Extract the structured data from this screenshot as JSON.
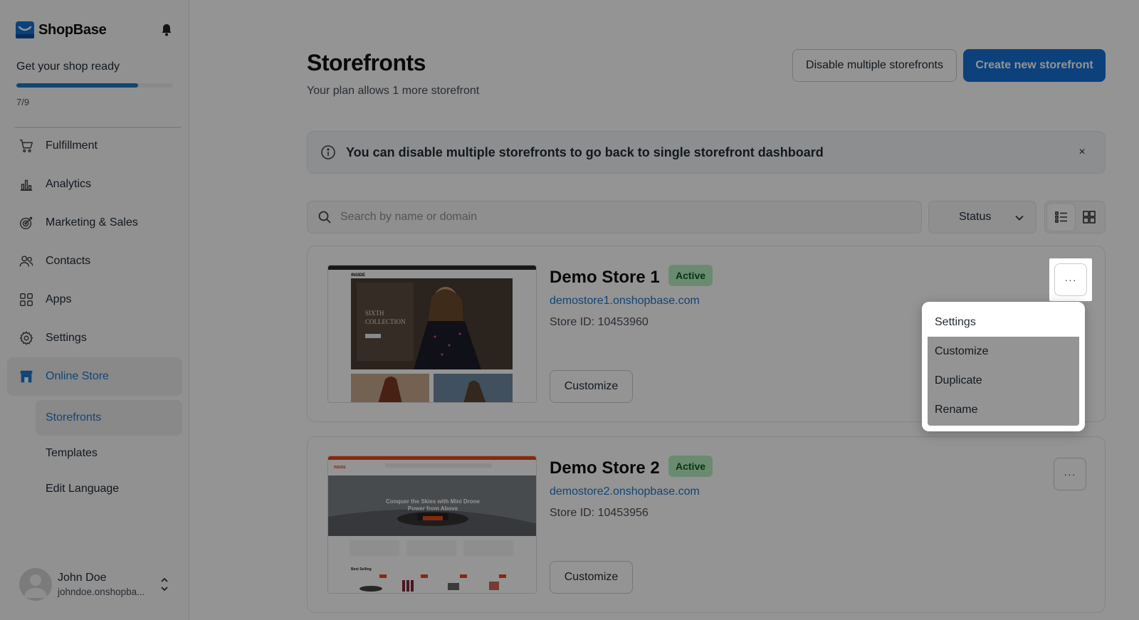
{
  "app": {
    "name": "ShopBase"
  },
  "sidebar": {
    "setup_title": "Get your shop ready",
    "setup_progress_fraction": 0.778,
    "setup_count": "7/9",
    "items": [
      {
        "label": "Fulfillment",
        "icon": "cart-icon"
      },
      {
        "label": "Analytics",
        "icon": "bar-chart-icon"
      },
      {
        "label": "Marketing & Sales",
        "icon": "target-icon"
      },
      {
        "label": "Contacts",
        "icon": "users-icon"
      },
      {
        "label": "Apps",
        "icon": "apps-grid-icon"
      },
      {
        "label": "Settings",
        "icon": "gear-icon"
      },
      {
        "label": "Online Store",
        "icon": "store-icon",
        "active": true
      }
    ],
    "sub_items": [
      {
        "label": "Storefronts",
        "active": true
      },
      {
        "label": "Templates"
      },
      {
        "label": "Edit Language"
      }
    ],
    "user": {
      "name": "John Doe",
      "domain": "johndoe.onshopba..."
    }
  },
  "header": {
    "title": "Storefronts",
    "subtitle": "Your plan allows 1 more storefront",
    "disable_button": "Disable multiple storefronts",
    "create_button": "Create new storefront"
  },
  "banner": {
    "text": "You can disable multiple storefronts to go back to single storefront dashboard",
    "close": "×"
  },
  "filters": {
    "search_placeholder": "Search by name or domain",
    "status_label": "Status"
  },
  "stores": [
    {
      "name": "Demo Store 1",
      "status": "Active",
      "domain": "demostore1.onshopbase.com",
      "store_id": "Store ID: 10453960",
      "customize": "Customize",
      "more": "···",
      "thumb_brand": "INSIDE",
      "thumb_headline_1": "SIXTH",
      "thumb_headline_2": "COLLECTION"
    },
    {
      "name": "Demo Store 2",
      "status": "Active",
      "domain": "demostore2.onshopbase.com",
      "store_id": "Store ID: 10453956",
      "customize": "Customize",
      "more": "···",
      "thumb_brand": "INSIDE",
      "thumb_headline_1": "Conquer the Skies with Mini Drone",
      "thumb_headline_2": "Power from Above",
      "thumb_section": "Best Selling"
    }
  ],
  "context_menu": {
    "items": [
      "Settings",
      "Customize",
      "Duplicate",
      "Rename"
    ]
  },
  "colors": {
    "accent": "#1570d6",
    "link": "#1e77c9",
    "badge_bg": "#b7efc2",
    "badge_text": "#0f5b26"
  }
}
